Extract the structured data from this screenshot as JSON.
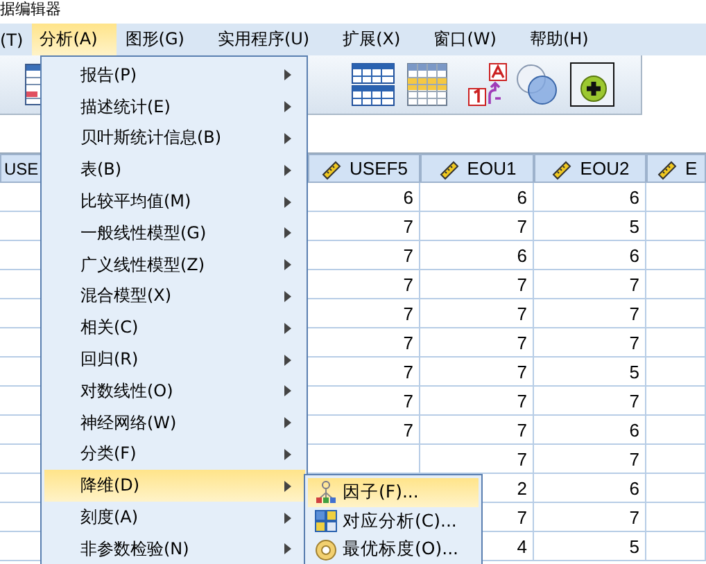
{
  "window": {
    "title": "据编辑器"
  },
  "menubar": [
    {
      "label": "(T)",
      "selected": false
    },
    {
      "label": "分析(A)",
      "selected": true
    },
    {
      "label": "图形(G)",
      "selected": false
    },
    {
      "label": "实用程序(U)",
      "selected": false
    },
    {
      "label": "扩展(X)",
      "selected": false
    },
    {
      "label": "窗口(W)",
      "selected": false
    },
    {
      "label": "帮助(H)",
      "selected": false
    }
  ],
  "grid": {
    "columns": [
      "USE",
      "USEF5",
      "EOU1",
      "EOU2",
      "E"
    ],
    "rows": [
      {
        "usef5": "6",
        "eou1": "6",
        "eou2": "6"
      },
      {
        "usef5": "7",
        "eou1": "7",
        "eou2": "5"
      },
      {
        "usef5": "7",
        "eou1": "6",
        "eou2": "6"
      },
      {
        "usef5": "7",
        "eou1": "7",
        "eou2": "7"
      },
      {
        "usef5": "7",
        "eou1": "7",
        "eou2": "7"
      },
      {
        "usef5": "7",
        "eou1": "7",
        "eou2": "7"
      },
      {
        "usef5": "7",
        "eou1": "7",
        "eou2": "5"
      },
      {
        "usef5": "7",
        "eou1": "7",
        "eou2": "7"
      },
      {
        "usef5": "7",
        "eou1": "7",
        "eou2": "6"
      },
      {
        "eou1": "7",
        "eou2": "7"
      },
      {
        "eou1": "2",
        "eou2": "6"
      },
      {
        "eou1": "7",
        "eou2": "7"
      },
      {
        "eou1": "4",
        "eou2": "5"
      }
    ]
  },
  "analyze_menu": {
    "items": [
      {
        "label": "报告(P)",
        "selected": false
      },
      {
        "label": "描述统计(E)",
        "selected": false
      },
      {
        "label": "贝叶斯统计信息(B)",
        "selected": false
      },
      {
        "label": "表(B)",
        "selected": false
      },
      {
        "label": "比较平均值(M)",
        "selected": false
      },
      {
        "label": "一般线性模型(G)",
        "selected": false
      },
      {
        "label": "广义线性模型(Z)",
        "selected": false
      },
      {
        "label": "混合模型(X)",
        "selected": false
      },
      {
        "label": "相关(C)",
        "selected": false
      },
      {
        "label": "回归(R)",
        "selected": false
      },
      {
        "label": "对数线性(O)",
        "selected": false
      },
      {
        "label": "神经网络(W)",
        "selected": false
      },
      {
        "label": "分类(F)",
        "selected": false
      },
      {
        "label": "降维(D)",
        "selected": true
      },
      {
        "label": "刻度(A)",
        "selected": false
      },
      {
        "label": "非参数检验(N)",
        "selected": false
      }
    ]
  },
  "submenu": {
    "items": [
      {
        "label": "因子(F)...",
        "selected": true
      },
      {
        "label": "对应分析(C)...",
        "selected": false
      },
      {
        "label": "最优标度(O)...",
        "selected": false
      }
    ]
  }
}
